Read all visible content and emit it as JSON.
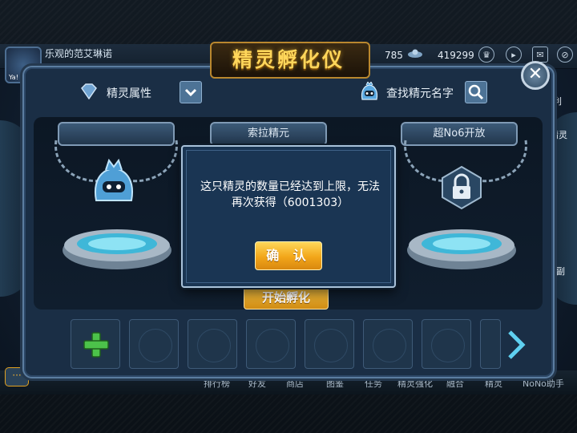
{
  "player": {
    "name": "乐观的范艾琳诺",
    "avatar_badge": "Ya!"
  },
  "resources": {
    "value_1": "785",
    "value_2": "419299"
  },
  "side_labels": {
    "right_1": "利",
    "right_2": "精灵",
    "right_3": "副"
  },
  "panel": {
    "title": "精灵孵化仪",
    "close_symbol": "✕",
    "filter_label": "精灵属性",
    "search_label": "查找精元名字",
    "slot_left_label": "",
    "slot_middle_label": "索拉精元",
    "slot_right_label": "超No6开放",
    "start_button": "开始孵化"
  },
  "bottom_nav": {
    "items": [
      "排行榜",
      "好友",
      "商店",
      "图鉴",
      "任务",
      "精灵强化",
      "融合",
      "精灵",
      "NoNo助手"
    ]
  },
  "dialog": {
    "message": "这只精灵的数量已经达到上限，无法再次获得（6001303）",
    "confirm_label": "确 认"
  },
  "colors": {
    "accent_gold": "#f2a619",
    "panel_blue": "#1a2e45",
    "dialog_blue": "#1a3553"
  }
}
